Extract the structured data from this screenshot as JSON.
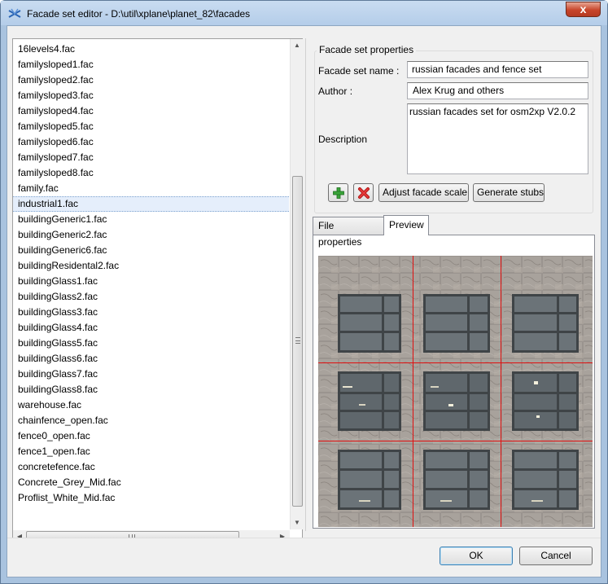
{
  "window": {
    "title": "Facade set editor - D:\\util\\xplane\\planet_82\\facades",
    "close_glyph": "x"
  },
  "file_list": {
    "items": [
      "16levels4.fac",
      "familysloped1.fac",
      "familysloped2.fac",
      "familysloped3.fac",
      "familysloped4.fac",
      "familysloped5.fac",
      "familysloped6.fac",
      "familysloped7.fac",
      "familysloped8.fac",
      "family.fac",
      "industrial1.fac",
      "buildingGeneric1.fac",
      "buildingGeneric2.fac",
      "buildingGeneric6.fac",
      "buildingResidental2.fac",
      "buildingGlass1.fac",
      "buildingGlass2.fac",
      "buildingGlass3.fac",
      "buildingGlass4.fac",
      "buildingGlass5.fac",
      "buildingGlass6.fac",
      "buildingGlass7.fac",
      "buildingGlass8.fac",
      "warehouse.fac",
      "chainfence_open.fac",
      "fence0_open.fac",
      "fence1_open.fac",
      "concretefence.fac",
      "Concrete_Grey_Mid.fac",
      "Proflist_White_Mid.fac"
    ],
    "selected_item": "industrial1.fac"
  },
  "facade_set": {
    "group_title": "Facade set properties",
    "name_label": "Facade set name :",
    "name_value": "russian facades and fence set",
    "author_label": "Author :",
    "author_value": "Alex Krug and others",
    "description_label": "Description",
    "description_value": "russian facades set for osm2xp V2.0.2"
  },
  "toolbar": {
    "add_icon": "plus-icon",
    "remove_icon": "delete-x-icon",
    "adjust_label": "Adjust facade scale",
    "stubs_label": "Generate stubs"
  },
  "tabs": {
    "file_properties": "File properties",
    "preview": "Preview",
    "active": "Preview"
  },
  "dialog": {
    "ok_label": "OK",
    "cancel_label": "Cancel"
  },
  "colors": {
    "guide_line": "#e01010",
    "accent": "#3c7fb1"
  }
}
